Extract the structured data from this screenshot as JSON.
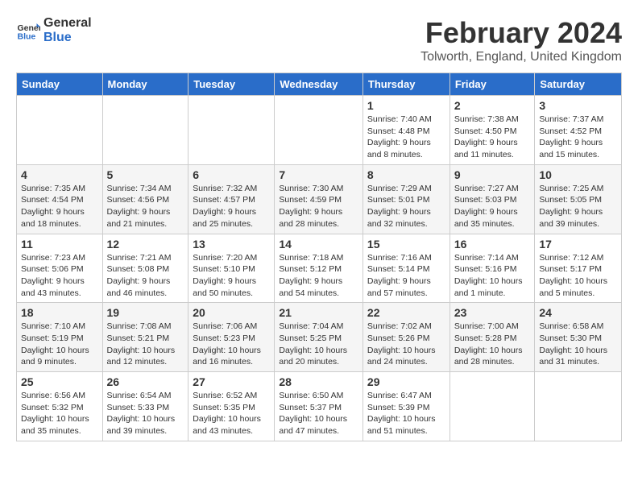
{
  "logo": {
    "line1": "General",
    "line2": "Blue"
  },
  "title": "February 2024",
  "location": "Tolworth, England, United Kingdom",
  "days_header": [
    "Sunday",
    "Monday",
    "Tuesday",
    "Wednesday",
    "Thursday",
    "Friday",
    "Saturday"
  ],
  "weeks": [
    [
      {
        "num": "",
        "info": ""
      },
      {
        "num": "",
        "info": ""
      },
      {
        "num": "",
        "info": ""
      },
      {
        "num": "",
        "info": ""
      },
      {
        "num": "1",
        "info": "Sunrise: 7:40 AM\nSunset: 4:48 PM\nDaylight: 9 hours\nand 8 minutes."
      },
      {
        "num": "2",
        "info": "Sunrise: 7:38 AM\nSunset: 4:50 PM\nDaylight: 9 hours\nand 11 minutes."
      },
      {
        "num": "3",
        "info": "Sunrise: 7:37 AM\nSunset: 4:52 PM\nDaylight: 9 hours\nand 15 minutes."
      }
    ],
    [
      {
        "num": "4",
        "info": "Sunrise: 7:35 AM\nSunset: 4:54 PM\nDaylight: 9 hours\nand 18 minutes."
      },
      {
        "num": "5",
        "info": "Sunrise: 7:34 AM\nSunset: 4:56 PM\nDaylight: 9 hours\nand 21 minutes."
      },
      {
        "num": "6",
        "info": "Sunrise: 7:32 AM\nSunset: 4:57 PM\nDaylight: 9 hours\nand 25 minutes."
      },
      {
        "num": "7",
        "info": "Sunrise: 7:30 AM\nSunset: 4:59 PM\nDaylight: 9 hours\nand 28 minutes."
      },
      {
        "num": "8",
        "info": "Sunrise: 7:29 AM\nSunset: 5:01 PM\nDaylight: 9 hours\nand 32 minutes."
      },
      {
        "num": "9",
        "info": "Sunrise: 7:27 AM\nSunset: 5:03 PM\nDaylight: 9 hours\nand 35 minutes."
      },
      {
        "num": "10",
        "info": "Sunrise: 7:25 AM\nSunset: 5:05 PM\nDaylight: 9 hours\nand 39 minutes."
      }
    ],
    [
      {
        "num": "11",
        "info": "Sunrise: 7:23 AM\nSunset: 5:06 PM\nDaylight: 9 hours\nand 43 minutes."
      },
      {
        "num": "12",
        "info": "Sunrise: 7:21 AM\nSunset: 5:08 PM\nDaylight: 9 hours\nand 46 minutes."
      },
      {
        "num": "13",
        "info": "Sunrise: 7:20 AM\nSunset: 5:10 PM\nDaylight: 9 hours\nand 50 minutes."
      },
      {
        "num": "14",
        "info": "Sunrise: 7:18 AM\nSunset: 5:12 PM\nDaylight: 9 hours\nand 54 minutes."
      },
      {
        "num": "15",
        "info": "Sunrise: 7:16 AM\nSunset: 5:14 PM\nDaylight: 9 hours\nand 57 minutes."
      },
      {
        "num": "16",
        "info": "Sunrise: 7:14 AM\nSunset: 5:16 PM\nDaylight: 10 hours\nand 1 minute."
      },
      {
        "num": "17",
        "info": "Sunrise: 7:12 AM\nSunset: 5:17 PM\nDaylight: 10 hours\nand 5 minutes."
      }
    ],
    [
      {
        "num": "18",
        "info": "Sunrise: 7:10 AM\nSunset: 5:19 PM\nDaylight: 10 hours\nand 9 minutes."
      },
      {
        "num": "19",
        "info": "Sunrise: 7:08 AM\nSunset: 5:21 PM\nDaylight: 10 hours\nand 12 minutes."
      },
      {
        "num": "20",
        "info": "Sunrise: 7:06 AM\nSunset: 5:23 PM\nDaylight: 10 hours\nand 16 minutes."
      },
      {
        "num": "21",
        "info": "Sunrise: 7:04 AM\nSunset: 5:25 PM\nDaylight: 10 hours\nand 20 minutes."
      },
      {
        "num": "22",
        "info": "Sunrise: 7:02 AM\nSunset: 5:26 PM\nDaylight: 10 hours\nand 24 minutes."
      },
      {
        "num": "23",
        "info": "Sunrise: 7:00 AM\nSunset: 5:28 PM\nDaylight: 10 hours\nand 28 minutes."
      },
      {
        "num": "24",
        "info": "Sunrise: 6:58 AM\nSunset: 5:30 PM\nDaylight: 10 hours\nand 31 minutes."
      }
    ],
    [
      {
        "num": "25",
        "info": "Sunrise: 6:56 AM\nSunset: 5:32 PM\nDaylight: 10 hours\nand 35 minutes."
      },
      {
        "num": "26",
        "info": "Sunrise: 6:54 AM\nSunset: 5:33 PM\nDaylight: 10 hours\nand 39 minutes."
      },
      {
        "num": "27",
        "info": "Sunrise: 6:52 AM\nSunset: 5:35 PM\nDaylight: 10 hours\nand 43 minutes."
      },
      {
        "num": "28",
        "info": "Sunrise: 6:50 AM\nSunset: 5:37 PM\nDaylight: 10 hours\nand 47 minutes."
      },
      {
        "num": "29",
        "info": "Sunrise: 6:47 AM\nSunset: 5:39 PM\nDaylight: 10 hours\nand 51 minutes."
      },
      {
        "num": "",
        "info": ""
      },
      {
        "num": "",
        "info": ""
      }
    ]
  ]
}
